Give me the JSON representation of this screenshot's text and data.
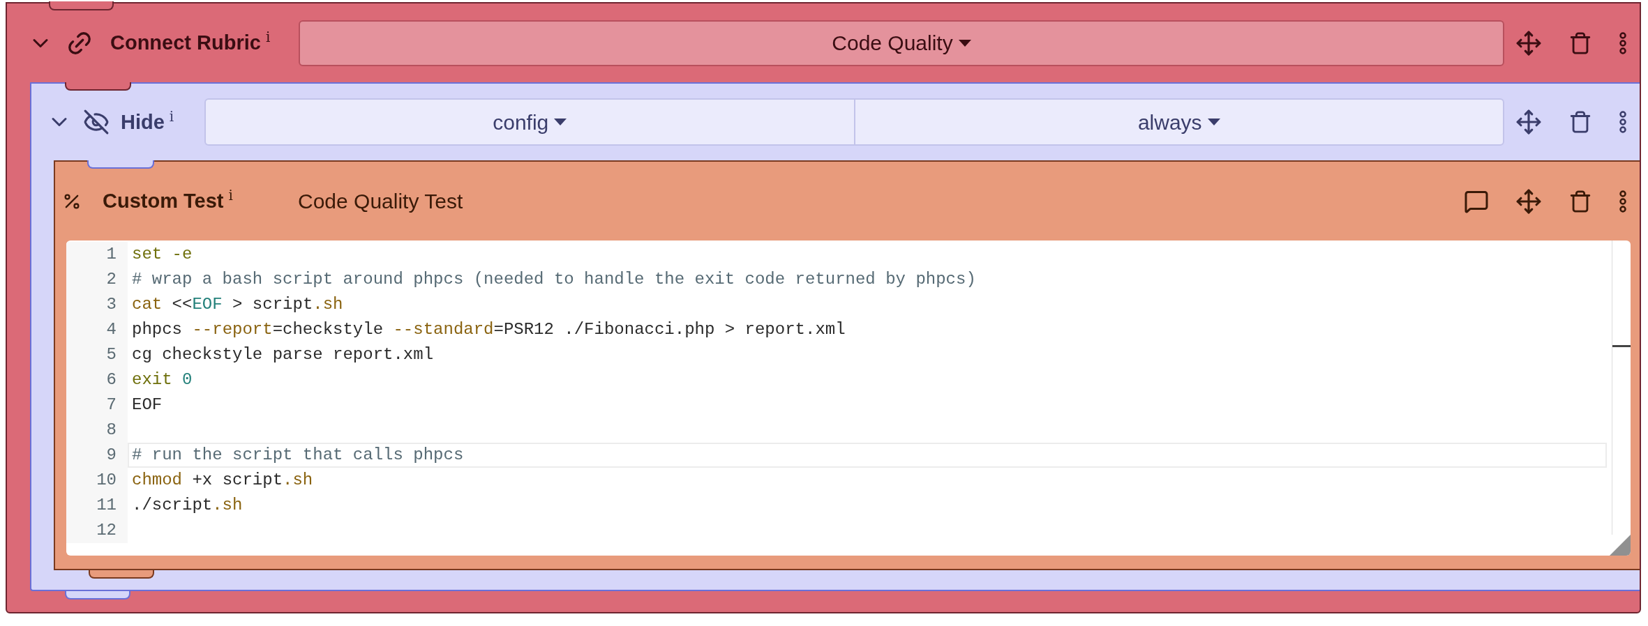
{
  "rubric_block": {
    "label": "Connect Rubric",
    "info": "i",
    "expanded": true,
    "dropdown": "Code Quality",
    "hide_block": {
      "label": "Hide",
      "info": "i",
      "expanded": true,
      "dropdowns": [
        "config",
        "always"
      ],
      "test_block": {
        "label": "Custom Test",
        "info": "i",
        "name": "Code Quality Test",
        "code": {
          "lines": [
            {
              "number": "1",
              "active": false,
              "tokens": [
                {
                  "kind": "builtin",
                  "text": "set -e"
                }
              ]
            },
            {
              "number": "2",
              "active": false,
              "tokens": [
                {
                  "kind": "comment",
                  "text": "# wrap a bash script around phpcs (needed to handle the exit code returned by phpcs)"
                }
              ]
            },
            {
              "number": "3",
              "active": false,
              "tokens": [
                {
                  "kind": "command",
                  "text": "cat"
                },
                {
                  "kind": "plain",
                  "text": " <<"
                },
                {
                  "kind": "heredoc",
                  "text": "EOF"
                },
                {
                  "kind": "plain",
                  "text": " > script"
                },
                {
                  "kind": "command",
                  "text": ".sh"
                }
              ]
            },
            {
              "number": "4",
              "active": false,
              "tokens": [
                {
                  "kind": "plain",
                  "text": "phpcs "
                },
                {
                  "kind": "command",
                  "text": "--report"
                },
                {
                  "kind": "plain",
                  "text": "=checkstyle "
                },
                {
                  "kind": "command",
                  "text": "--standard"
                },
                {
                  "kind": "plain",
                  "text": "=PSR12 ./Fibonacci.php > report.xml"
                }
              ]
            },
            {
              "number": "5",
              "active": false,
              "tokens": [
                {
                  "kind": "plain",
                  "text": "cg checkstyle parse report.xml"
                }
              ]
            },
            {
              "number": "6",
              "active": false,
              "tokens": [
                {
                  "kind": "builtin",
                  "text": "exit"
                },
                {
                  "kind": "number",
                  "text": " 0"
                }
              ]
            },
            {
              "number": "7",
              "active": false,
              "tokens": [
                {
                  "kind": "plain",
                  "text": "EOF"
                }
              ]
            },
            {
              "number": "8",
              "active": false
            },
            {
              "number": "9",
              "active": true,
              "tokens": [
                {
                  "kind": "comment",
                  "text": "# run the script that calls phpcs"
                }
              ]
            },
            {
              "number": "10",
              "active": false,
              "tokens": [
                {
                  "kind": "command",
                  "text": "chmod"
                },
                {
                  "kind": "plain",
                  "text": " +x script"
                },
                {
                  "kind": "command",
                  "text": ".sh"
                }
              ]
            },
            {
              "number": "11",
              "active": false,
              "tokens": [
                {
                  "kind": "plain",
                  "text": "./script"
                },
                {
                  "kind": "command",
                  "text": ".sh"
                }
              ]
            },
            {
              "number": "12",
              "active": false
            }
          ]
        }
      }
    }
  }
}
